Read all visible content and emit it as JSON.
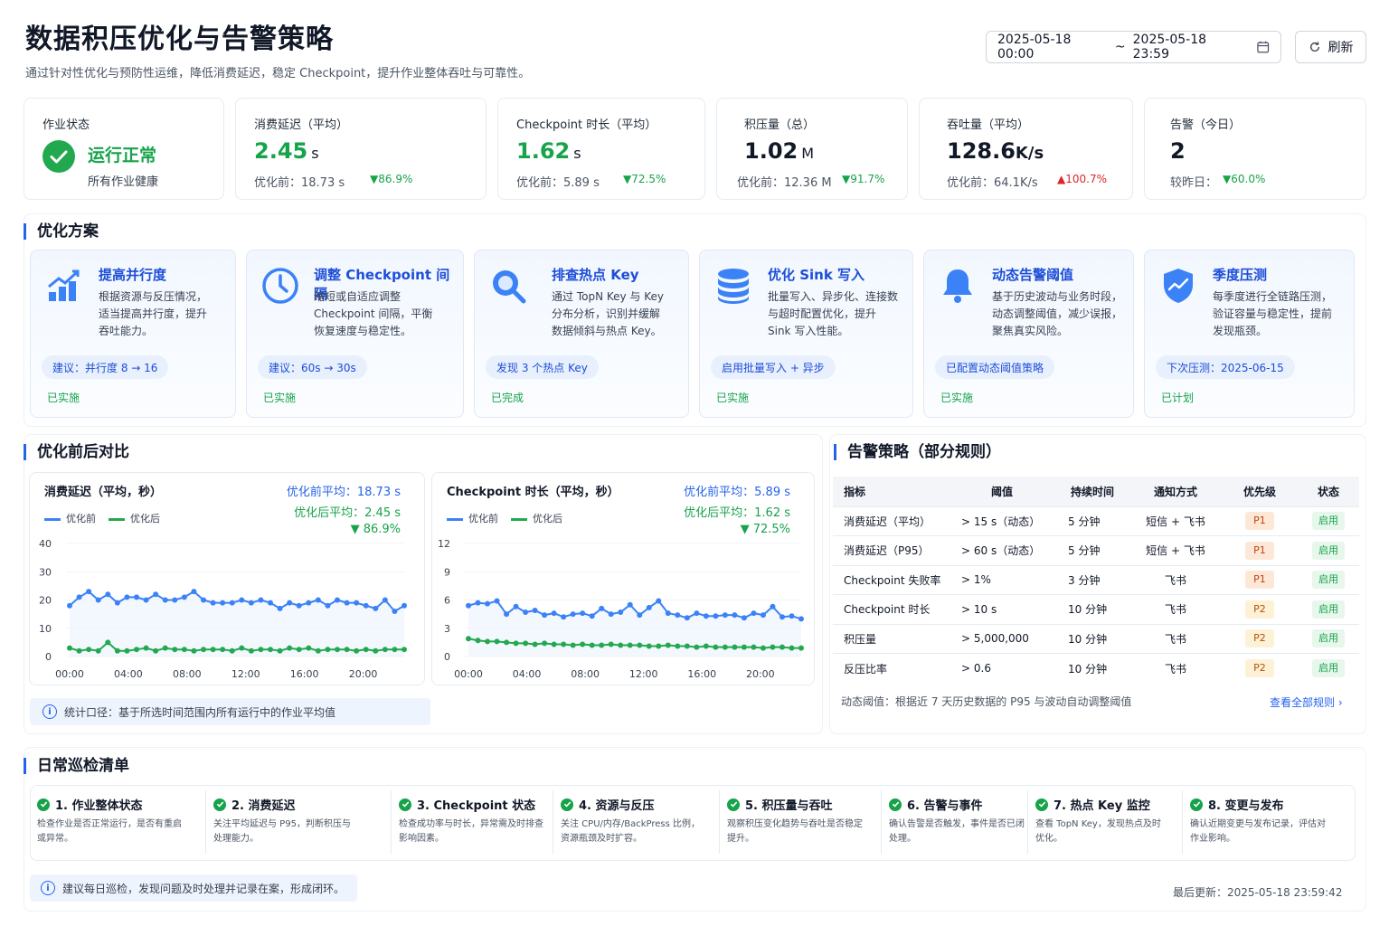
{
  "header": {
    "title": "数据积压优化与告警策略",
    "subtitle": "通过针对性优化与预防性运维，降低消费延迟，稳定 Checkpoint，提升作业整体吞吐与可靠性。",
    "date_start": "2025-05-18 00:00",
    "date_sep": "~",
    "date_end": "2025-05-18 23:59",
    "refresh_label": "刷新"
  },
  "kpis": [
    {
      "label": "作业状态",
      "value": "运行正常",
      "sub": "所有作业健康"
    },
    {
      "label": "消费延迟（平均）",
      "value": "2.45",
      "unit": "s",
      "sub": "优化前：18.73 s",
      "change": "▼86.9%"
    },
    {
      "label": "Checkpoint 时长（平均）",
      "value": "1.62",
      "unit": "s",
      "sub": "优化前：5.89 s",
      "change": "▼72.5%"
    },
    {
      "label": "积压量（总）",
      "value": "1.02",
      "unit": "M",
      "sub": "优化前：12.36 M",
      "change": "▼91.7%"
    },
    {
      "label": "吞吐量（平均）",
      "value": "128.6",
      "unit": "K/s",
      "sub": "优化前：64.1K/s",
      "change": "▲100.7%"
    },
    {
      "label": "告警（今日）",
      "value": "2",
      "sub": "较昨日：",
      "change": "▼60.0%"
    }
  ],
  "sections": {
    "optimization": "优化方案",
    "comparison": "优化前后对比",
    "alert_policy": "告警策略（部分规则）",
    "daily_check": "日常巡检清单"
  },
  "optimizations": [
    {
      "icon": "trend-up-chart-icon",
      "title": "提高并行度",
      "desc": "根据资源与反压情况，\n适当提高并行度，提升\n吞吐能力。",
      "tag": "建议：并行度 8 → 16",
      "status": "已实施"
    },
    {
      "icon": "clock-icon",
      "title": "调整 Checkpoint 间隔",
      "desc": "缩短或自适应调整\nCheckpoint 间隔，平衡\n恢复速度与稳定性。",
      "tag": "建议：60s → 30s",
      "status": "已实施"
    },
    {
      "icon": "magnifier-icon",
      "title": "排查热点 Key",
      "desc": "通过 TopN Key 与 Key\n分布分析，识别并缓解\n数据倾斜与热点 Key。",
      "tag": "发现 3 个热点 Key",
      "status": "已完成"
    },
    {
      "icon": "database-icon",
      "title": "优化 Sink 写入",
      "desc": "批量写入、异步化、连接数\n与超时配置优化，提升\nSink 写入性能。",
      "tag": "启用批量写入 + 异步",
      "status": "已实施"
    },
    {
      "icon": "bell-icon",
      "title": "动态告警阈值",
      "desc": "基于历史波动与业务时段，\n动态调整阈值，减少误报，\n聚焦真实风险。",
      "tag": "已配置动态阈值策略",
      "status": "已实施"
    },
    {
      "icon": "shield-chart-icon",
      "title": "季度压测",
      "desc": "每季度进行全链路压测，\n验证容量与稳定性，提前\n发现瓶颈。",
      "tag": "下次压测：2025-06-15",
      "status": "已计划"
    }
  ],
  "charts": {
    "note": "统计口径：基于所选时间范围内所有运行中的作业平均值",
    "latency": {
      "title": "消费延迟（平均，秒）",
      "avg_before": "优化前平均：18.73 s",
      "avg_after": "优化后平均：2.45 s",
      "change": "▼ 86.9%"
    },
    "checkpoint": {
      "title": "Checkpoint 时长（平均，秒）",
      "avg_before": "优化前平均：5.89 s",
      "avg_after": "优化后平均：1.62 s",
      "change": "▼ 72.5%"
    },
    "legend_before": "优化前",
    "legend_after": "优化后",
    "colors": {
      "before": "#3b82f6",
      "after": "#22a94f"
    }
  },
  "chart_data": [
    {
      "type": "line",
      "title": "消费延迟（平均，秒）",
      "x": [
        "00:00",
        "01:00",
        "02:00",
        "03:00",
        "04:00",
        "05:00",
        "06:00",
        "07:00",
        "08:00",
        "09:00",
        "10:00",
        "11:00",
        "12:00",
        "13:00",
        "14:00",
        "15:00",
        "16:00",
        "17:00",
        "18:00",
        "19:00",
        "20:00",
        "21:00",
        "22:00",
        "23:00"
      ],
      "x_ticks": [
        "00:00",
        "04:00",
        "08:00",
        "12:00",
        "16:00",
        "20:00"
      ],
      "y_ticks": [
        "0",
        "10",
        "20",
        "30",
        "40"
      ],
      "ylim": [
        0,
        40
      ],
      "series": [
        {
          "name": "优化前",
          "values": [
            18,
            21,
            23,
            20,
            22,
            19,
            21,
            21,
            20,
            22,
            20,
            20,
            21,
            23,
            20,
            19,
            19,
            19,
            20,
            19,
            20,
            19,
            17,
            19,
            18,
            19,
            20,
            18,
            20,
            19,
            19,
            18,
            17,
            20,
            16,
            18
          ]
        },
        {
          "name": "优化后",
          "values": [
            3,
            2,
            2.5,
            2,
            5,
            2,
            2,
            2.5,
            3,
            2,
            3,
            2.5,
            2.5,
            2,
            2.5,
            2.5,
            2.5,
            2,
            3,
            2,
            2.5,
            2.5,
            2,
            3,
            2.5,
            3,
            2,
            2.5,
            2.5,
            2.5,
            2,
            2.5,
            2,
            2.5,
            2.5,
            2.5
          ]
        }
      ]
    },
    {
      "type": "line",
      "title": "Checkpoint 时长（平均，秒）",
      "x": [
        "00:00",
        "01:00",
        "02:00",
        "03:00",
        "04:00",
        "05:00",
        "06:00",
        "07:00",
        "08:00",
        "09:00",
        "10:00",
        "11:00",
        "12:00",
        "13:00",
        "14:00",
        "15:00",
        "16:00",
        "17:00",
        "18:00",
        "19:00",
        "20:00",
        "21:00",
        "22:00",
        "23:00"
      ],
      "x_ticks": [
        "00:00",
        "04:00",
        "08:00",
        "12:00",
        "16:00",
        "20:00"
      ],
      "y_ticks": [
        "0",
        "3",
        "6",
        "9",
        "12"
      ],
      "ylim": [
        0,
        12
      ],
      "series": [
        {
          "name": "优化前",
          "values": [
            5.4,
            5.7,
            5.6,
            5.9,
            4.5,
            5.3,
            4.7,
            4.9,
            4.4,
            4.6,
            4.2,
            4.5,
            4.6,
            4.3,
            5.1,
            4.5,
            4.7,
            5.5,
            4.4,
            5.2,
            5.9,
            4.6,
            4.4,
            4.1,
            4.6,
            4.3,
            4.3,
            4.4,
            4.4,
            4.1,
            4.6,
            4.4,
            5.3,
            4.2,
            4.3,
            4.0
          ]
        },
        {
          "name": "优化后",
          "values": [
            1.9,
            1.7,
            1.6,
            1.6,
            1.5,
            1.4,
            1.4,
            1.3,
            1.4,
            1.3,
            1.3,
            1.2,
            1.3,
            1.2,
            1.2,
            1.3,
            1.2,
            1.2,
            1.2,
            1.1,
            1.1,
            1.2,
            1.1,
            1.1,
            1.0,
            1.1,
            1.0,
            1.0,
            1.0,
            1.0,
            1.0,
            0.9,
            1.0,
            1.0,
            0.9,
            0.9
          ]
        }
      ]
    }
  ],
  "alert_table": {
    "headers": [
      "指标",
      "阈值",
      "持续时间",
      "通知方式",
      "优先级",
      "状态"
    ],
    "rows": [
      {
        "metric": "消费延迟（平均）",
        "threshold": "> 15 s（动态）",
        "duration": "5 分钟",
        "notify": "短信 + 飞书",
        "priority": "P1",
        "status": "启用"
      },
      {
        "metric": "消费延迟（P95）",
        "threshold": "> 60 s（动态）",
        "duration": "5 分钟",
        "notify": "短信 + 飞书",
        "priority": "P1",
        "status": "启用"
      },
      {
        "metric": "Checkpoint 失败率",
        "threshold": "> 1%",
        "duration": "3 分钟",
        "notify": "飞书",
        "priority": "P1",
        "status": "启用"
      },
      {
        "metric": "Checkpoint 时长",
        "threshold": "> 10 s",
        "duration": "10 分钟",
        "notify": "飞书",
        "priority": "P2",
        "status": "启用"
      },
      {
        "metric": "积压量",
        "threshold": "> 5,000,000",
        "duration": "10 分钟",
        "notify": "飞书",
        "priority": "P2",
        "status": "启用"
      },
      {
        "metric": "反压比率",
        "threshold": "> 0.6",
        "duration": "10 分钟",
        "notify": "飞书",
        "priority": "P2",
        "status": "启用"
      }
    ],
    "footnote": "动态阈值：根据近 7 天历史数据的 P95 与波动自动调整阈值",
    "view_all": "查看全部规则 ›"
  },
  "checklist": [
    {
      "title": "1. 作业整体状态",
      "desc": "检查作业是否正常运行，是否有重启\n或异常。"
    },
    {
      "title": "2. 消费延迟",
      "desc": "关注平均延迟与 P95，判断积压与\n处理能力。"
    },
    {
      "title": "3. Checkpoint 状态",
      "desc": "检查成功率与时长，异常需及时排查\n影响因素。"
    },
    {
      "title": "4. 资源与反压",
      "desc": "关注 CPU/内存/BackPress 比例，\n资源瓶颈及时扩容。"
    },
    {
      "title": "5. 积压量与吞吐",
      "desc": "观察积压变化趋势与吞吐是否稳定\n提升。"
    },
    {
      "title": "6. 告警与事件",
      "desc": "确认告警是否触发，事件是否已闭\n处理。"
    },
    {
      "title": "7. 热点 Key 监控",
      "desc": "查看 TopN Key，发现热点及时\n优化。"
    },
    {
      "title": "8. 变更与发布",
      "desc": "确认近期变更与发布记录，评估对\n作业影响。"
    }
  ],
  "footer": {
    "tip": "建议每日巡检，发现问题及时处理并记录在案，形成闭环。",
    "last_updated": "最后更新：2025-05-18 23:59:42"
  }
}
